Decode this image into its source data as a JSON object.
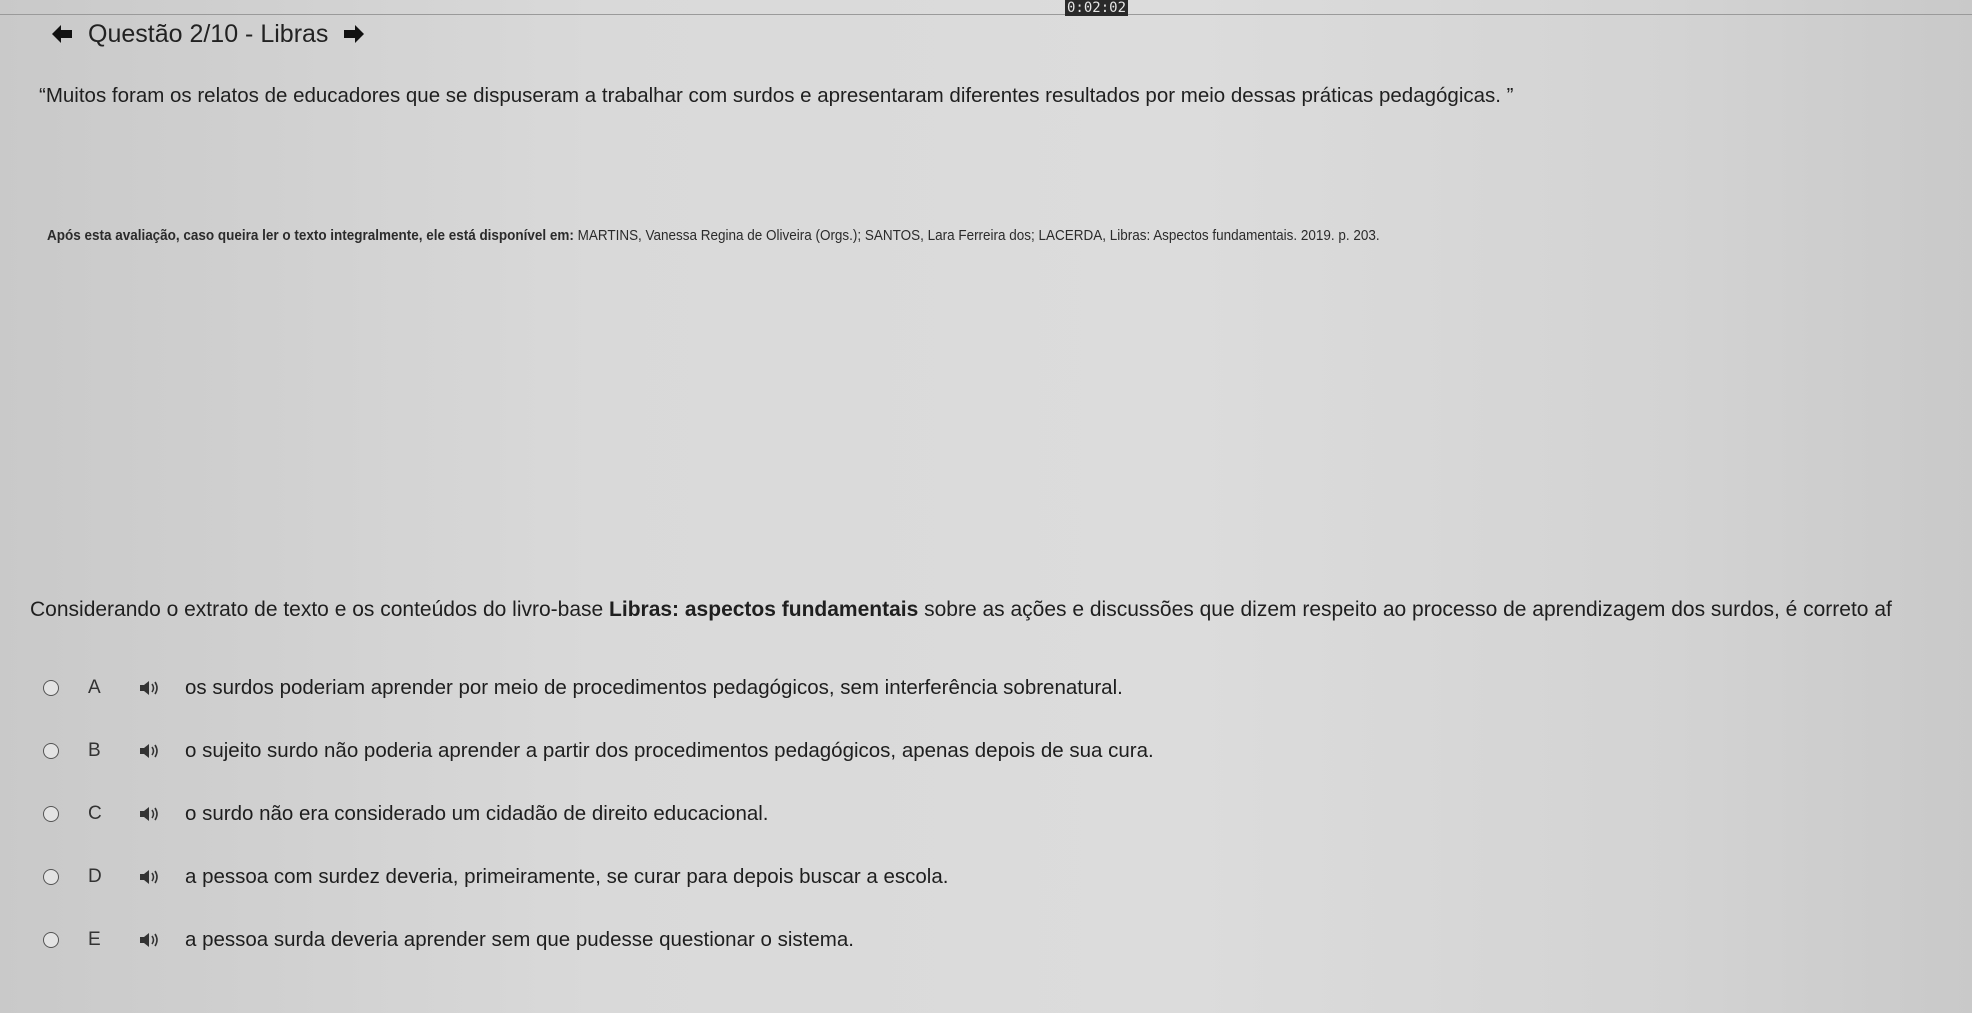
{
  "timer": "0:02:02",
  "header": {
    "title": "Questão 2/10 - Libras",
    "prev_icon": "arrow-left-icon",
    "next_icon": "arrow-right-icon"
  },
  "quote": "“Muitos foram os relatos de educadores que se dispuseram a trabalhar com surdos e apresentaram diferentes resultados por meio dessas práticas pedagógicas. ”",
  "source": {
    "lead": "Após esta avaliação, caso queira ler o texto integralmente, ele está disponível em:",
    "reference": " MARTINS, Vanessa Regina de Oliveira (Orgs.); SANTOS, Lara Ferreira dos; LACERDA, Libras: Aspectos fundamentais. 2019. p. 203."
  },
  "prompt": {
    "before": "Considerando o extrato de texto e os conteúdos do livro-base ",
    "book": "Libras: aspectos fundamentais",
    "after": " sobre as ações e discussões que dizem respeito ao processo de aprendizagem dos surdos, é correto af"
  },
  "options": [
    {
      "letter": "A",
      "text": "os surdos poderiam aprender por meio de procedimentos pedagógicos, sem interferência sobrenatural.",
      "selected": false
    },
    {
      "letter": "B",
      "text": "o sujeito surdo não poderia aprender a partir dos procedimentos pedagógicos, apenas depois de sua cura.",
      "selected": false
    },
    {
      "letter": "C",
      "text": "o surdo não era considerado um cidadão de direito educacional.",
      "selected": false
    },
    {
      "letter": "D",
      "text": "a pessoa com surdez deveria, primeiramente, se curar para depois buscar a escola.",
      "selected": false
    },
    {
      "letter": "E",
      "text": "a pessoa surda deveria aprender sem que pudesse questionar o sistema.",
      "selected": false
    }
  ],
  "colors": {
    "background": "#d7d7d7",
    "text": "#1f1f1f"
  }
}
